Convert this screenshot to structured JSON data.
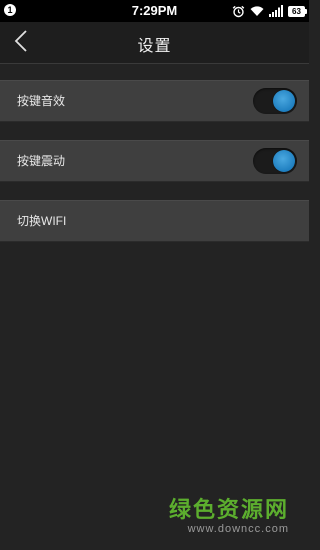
{
  "status_bar": {
    "notification_count": "1",
    "time": "7:29PM",
    "battery_level": "63",
    "icons": [
      "alarm-icon",
      "wifi-icon",
      "signal-icon",
      "battery-icon"
    ]
  },
  "header": {
    "title": "设置",
    "back_icon": "chevron-left-icon"
  },
  "settings": {
    "key_sound": {
      "label": "按键音效",
      "enabled": true
    },
    "key_vibrate": {
      "label": "按键震动",
      "enabled": true
    },
    "switch_wifi": {
      "label": "切换WIFI"
    }
  },
  "watermark": {
    "name": "绿色资源网",
    "url": "www.downcc.com"
  },
  "colors": {
    "background": "#232323",
    "row": "#3f3f3f",
    "toggle_on": "#1f7fc0",
    "watermark": "#5cae2e"
  }
}
